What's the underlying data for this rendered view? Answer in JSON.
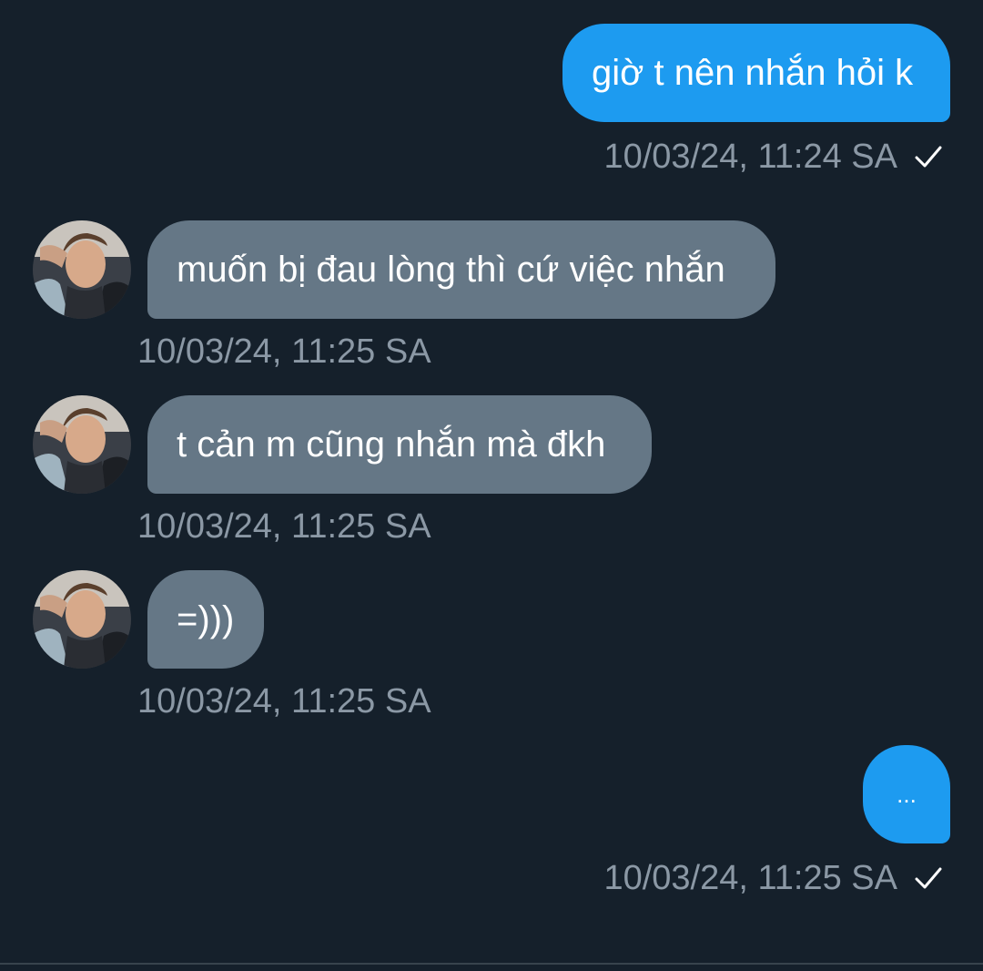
{
  "messages": [
    {
      "direction": "outgoing",
      "text": "giờ t nên nhắn hỏi k",
      "timestamp": "10/03/24, 11:24 SA",
      "status": "sent"
    },
    {
      "direction": "incoming",
      "text": "muốn bị đau lòng thì cứ việc nhắn",
      "timestamp": "10/03/24, 11:25 SA"
    },
    {
      "direction": "incoming",
      "text": "t cản m cũng nhắn mà đkh",
      "timestamp": "10/03/24, 11:25 SA"
    },
    {
      "direction": "incoming",
      "text": "=)))",
      "timestamp": "10/03/24, 11:25 SA"
    },
    {
      "direction": "outgoing",
      "text": "...",
      "timestamp": "10/03/24, 11:25 SA",
      "status": "sent"
    }
  ],
  "icons": {
    "sent_check": "checkmark-icon",
    "avatar": "user-avatar"
  },
  "colors": {
    "background": "#15202b",
    "outgoing_bubble": "#1d9bf0",
    "incoming_bubble": "#657786",
    "timestamp": "#8b98a5",
    "text": "#ffffff"
  }
}
